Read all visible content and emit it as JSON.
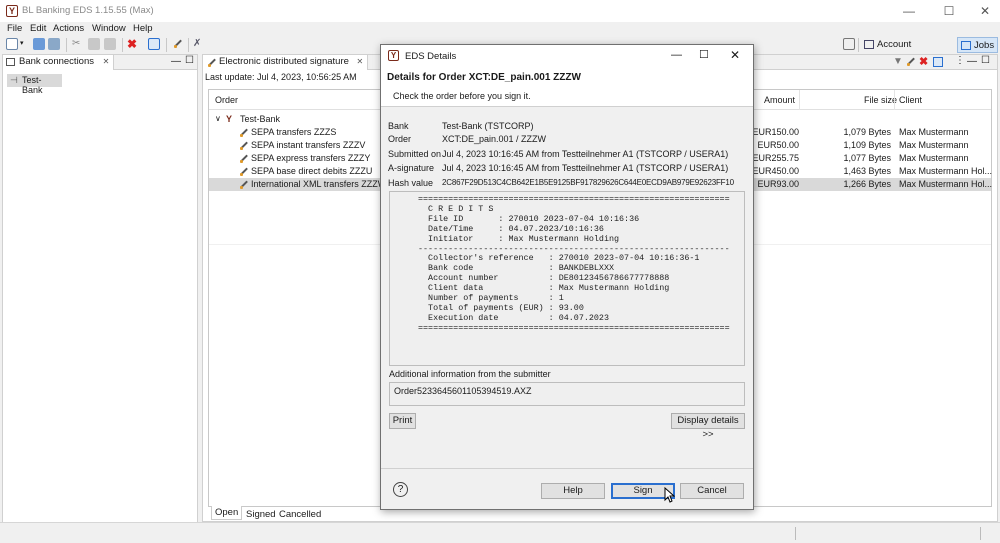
{
  "window": {
    "title": "BL Banking EDS 1.15.55 (Max)",
    "minimize": "—",
    "maximize": "☐",
    "close": "✕"
  },
  "menu": [
    "File",
    "Edit",
    "Actions",
    "Window",
    "Help"
  ],
  "perspectives": {
    "account_statements": "Account statements",
    "jobs": "Jobs"
  },
  "left_panel": {
    "tab": "Bank connections",
    "tab_close": "✕",
    "tree_root": "Test-Bank"
  },
  "main_panel": {
    "tab": "Electronic distributed signature",
    "tab_close": "✕",
    "last_update": "Last update: Jul 4, 2023, 10:56:25 AM",
    "columns": {
      "order": "Order",
      "amount": "Amount",
      "file_size": "File size",
      "client": "Client"
    },
    "group": "Test-Bank",
    "rows": [
      {
        "order": "SEPA transfers ZZZS",
        "amount": "EUR150.00",
        "size": "1,079 Bytes",
        "client": "Max Mustermann"
      },
      {
        "order": "SEPA instant transfers ZZZV",
        "amount": "EUR50.00",
        "size": "1,109 Bytes",
        "client": "Max Mustermann"
      },
      {
        "order": "SEPA express transfers ZZZY",
        "amount": "EUR255.75",
        "size": "1,077 Bytes",
        "client": "Max Mustermann"
      },
      {
        "order": "SEPA base direct debits ZZZU",
        "amount": "EUR450.00",
        "size": "1,463 Bytes",
        "client": "Max Mustermann Hol..."
      },
      {
        "order": "International XML transfers ZZZW",
        "amount": "EUR93.00",
        "size": "1,266 Bytes",
        "client": "Max Mustermann Hol..."
      }
    ],
    "bottom_tabs": [
      "Open",
      "Signed",
      "Cancelled"
    ]
  },
  "dialog": {
    "title": "EDS Details",
    "heading": "Details for Order XCT:DE_pain.001 ZZZW",
    "subheading": "Check the order before you sign it.",
    "fields": [
      {
        "label": "Bank",
        "value": "Test-Bank (TSTCORP)"
      },
      {
        "label": "Order",
        "value": "XCT:DE_pain.001 / ZZZW"
      },
      {
        "label": "Submitted on",
        "value": "Jul 4, 2023 10:16:45 AM from Testteilnehmer A1 (TSTCORP / USERA1)"
      },
      {
        "label": "A-signature",
        "value": "Jul 4, 2023 10:16:45 AM from Testteilnehmer A1 (TSTCORP / USERA1)"
      },
      {
        "label": "Hash value",
        "value": "2C867F29D513C4CB642E1B5E9125BF917829626C644E0ECD9AB979E92623FF10"
      }
    ],
    "memo": "==============================================================\n  C R E D I T S\n  File ID       : 270010 2023-07-04 10:16:36\n  Date/Time     : 04.07.2023/10:16:36\n  Initiator     : Max Mustermann Holding\n--------------------------------------------------------------\n  Collector's reference   : 270010 2023-07-04 10:16:36-1\n  Bank code               : BANKDEBLXXX\n  Account number          : DE80123456786677778888\n  Client data             : Max Mustermann Holding\n  Number of payments      : 1\n  Total of payments (EUR) : 93.00\n  Execution date          : 04.07.2023\n==============================================================",
    "additional_label": "Additional information from the submitter",
    "additional_value": "Order5233645601105394519.AXZ",
    "print": "Print",
    "display_details": "Display details >>",
    "help_icon": "?",
    "help": "Help",
    "sign": "Sign",
    "cancel": "Cancel"
  },
  "colors": {
    "accent": "#2a6fcf",
    "selection": "#d9d9d9",
    "perspective_active": "#d6e6f7"
  }
}
